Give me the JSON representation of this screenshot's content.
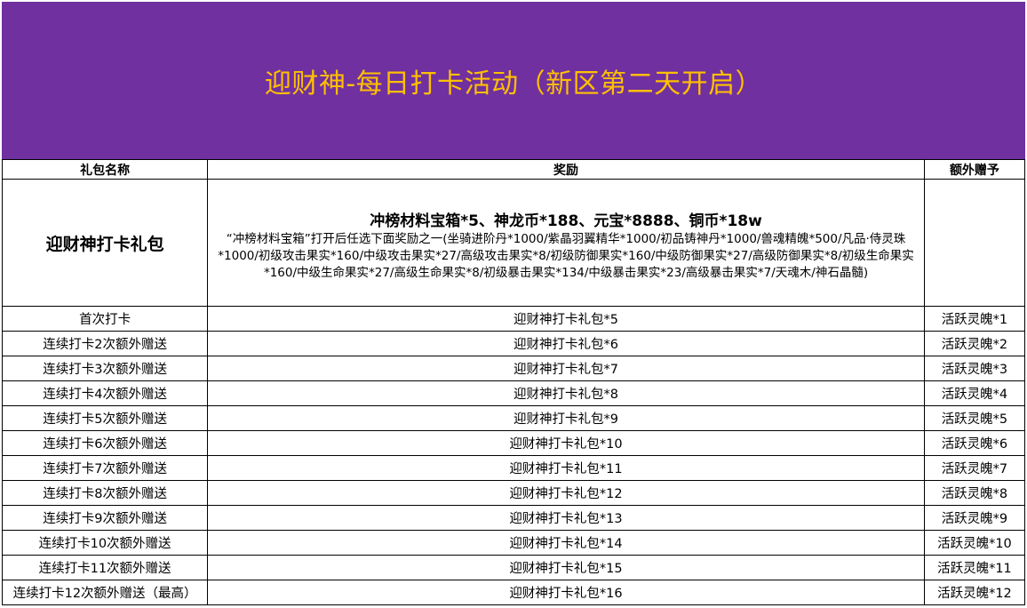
{
  "banner": {
    "title": "迎财神-每日打卡活动（新区第二天开启）"
  },
  "columns": {
    "name": "礼包名称",
    "reward": "奖励",
    "extra": "额外赠予"
  },
  "main_gift": {
    "name": "迎财神打卡礼包",
    "reward_headline": "冲榜材料宝箱*5、神龙币*188、元宝*8888、铜币*18w",
    "reward_detail": "“冲榜材料宝箱”打开后任选下面奖励之一(坐骑进阶丹*1000/紫晶羽翼精华*1000/初品铸神丹*1000/兽魂精魄*500/凡品·侍灵珠*1000/初级攻击果实*160/中级攻击果实*27/高级攻击果实*8/初级防御果实*160/中级防御果实*27/高级防御果实*8/初级生命果实*160/中级生命果实*27/高级生命果实*8/初级暴击果实*134/中级暴击果实*23/高级暴击果实*7/天魂木/神石晶髓)",
    "extra": ""
  },
  "rows": [
    {
      "name": "首次打卡",
      "reward": "迎财神打卡礼包*5",
      "extra": "活跃灵魄*1"
    },
    {
      "name": "连续打卡2次额外赠送",
      "reward": "迎财神打卡礼包*6",
      "extra": "活跃灵魄*2"
    },
    {
      "name": "连续打卡3次额外赠送",
      "reward": "迎财神打卡礼包*7",
      "extra": "活跃灵魄*3"
    },
    {
      "name": "连续打卡4次额外赠送",
      "reward": "迎财神打卡礼包*8",
      "extra": "活跃灵魄*4"
    },
    {
      "name": "连续打卡5次额外赠送",
      "reward": "迎财神打卡礼包*9",
      "extra": "活跃灵魄*5"
    },
    {
      "name": "连续打卡6次额外赠送",
      "reward": "迎财神打卡礼包*10",
      "extra": "活跃灵魄*6"
    },
    {
      "name": "连续打卡7次额外赠送",
      "reward": "迎财神打卡礼包*11",
      "extra": "活跃灵魄*7"
    },
    {
      "name": "连续打卡8次额外赠送",
      "reward": "迎财神打卡礼包*12",
      "extra": "活跃灵魄*8"
    },
    {
      "name": "连续打卡9次额外赠送",
      "reward": "迎财神打卡礼包*13",
      "extra": "活跃灵魄*9"
    },
    {
      "name": "连续打卡10次额外赠送",
      "reward": "迎财神打卡礼包*14",
      "extra": "活跃灵魄*10"
    },
    {
      "name": "连续打卡11次额外赠送",
      "reward": "迎财神打卡礼包*15",
      "extra": "活跃灵魄*11"
    },
    {
      "name": "连续打卡12次额外赠送（最高）",
      "reward": "迎财神打卡礼包*16",
      "extra": "活跃灵魄*12"
    }
  ],
  "colors": {
    "banner_bg": "#7030a0",
    "banner_text": "#ffc000",
    "grid_line": "#000000"
  }
}
